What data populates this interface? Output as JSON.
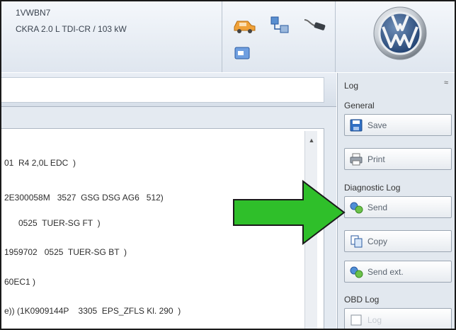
{
  "vehicle": {
    "vin": "1VWBN7",
    "engine": "CKRA 2.0 L TDI-CR / 103 kW"
  },
  "header_icons": [
    "car-icon",
    "network-icon",
    "cable-icon",
    "usb-icon"
  ],
  "brand": {
    "logo": "vw-logo"
  },
  "control_units": [
    "01  R4 2,0L EDC  )",
    "2E300058M   3527  GSG DSG AG6   512)",
    "0525  TUER-SG FT  )",
    "1959702   0525  TUER-SG BT  )",
    "60EC1 )",
    "e)) (1K0909144P    3305  EPS_ZFLS Kl. 290  )"
  ],
  "log_panel": {
    "title": "Log",
    "collapse_glyph": "≈",
    "general_label": "General",
    "save_label": "Save",
    "print_label": "Print",
    "diagnostic_label": "Diagnostic Log",
    "send_label": "Send",
    "copy_label": "Copy",
    "send_ext_label": "Send ext.",
    "obd_label": "OBD Log",
    "obd_button_label": "Log"
  },
  "scroll": {
    "up_glyph": "▲"
  },
  "colors": {
    "arrow_fill": "#2fbf2a",
    "arrow_stroke": "#1a1a1a",
    "panel_bg": "#e2e8ef"
  }
}
